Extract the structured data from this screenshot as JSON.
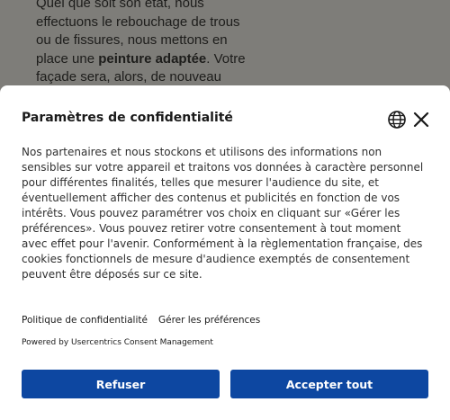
{
  "background": {
    "lines": [
      {
        "before": " Quel que soit son état, nous",
        "bold": "",
        "after": ""
      },
      {
        "before": "effectuons le rebouchage de trous",
        "bold": "",
        "after": ""
      },
      {
        "before": "ou de fissures, nous mettons en",
        "bold": "",
        "after": ""
      },
      {
        "before": "place une ",
        "bold": "peinture adaptée",
        "after": ". Votre"
      },
      {
        "before": "façade sera, alors, de nouveau",
        "bold": "",
        "after": ""
      }
    ]
  },
  "dialog": {
    "title": "Paramètres de confidentialité",
    "body_lines": [
      "Nos partenaires et nous stockons et utilisons des informations non",
      "sensibles sur votre appareil et traitons vos données à caractère personnel",
      "pour différentes finalités, telles que mesurer l'audience du site, et",
      "éventuellement afficher des contenus et publicités en fonction de vos",
      "intérêts. Vous pouvez paramétrer vos choix en cliquant sur «Gérer les",
      "préférences». Vous pouvez retirer votre consentement à tout moment",
      "avec effet pour l'avenir. Conformément à la règlementation française, des",
      "cookies fonctionnels de mesure d'audience exemptés de consentement",
      "peuvent être déposés sur ce site."
    ],
    "privacy_link": "Politique de confidentialité",
    "preferences_link": "Gérer les préférences",
    "powered_by": "Powered by Usercentrics Consent Management",
    "deny_button": "Refuser",
    "accept_button": "Accepter tout",
    "accent_color": "#0d47a1",
    "icons": [
      "globe-icon",
      "close-icon"
    ]
  }
}
